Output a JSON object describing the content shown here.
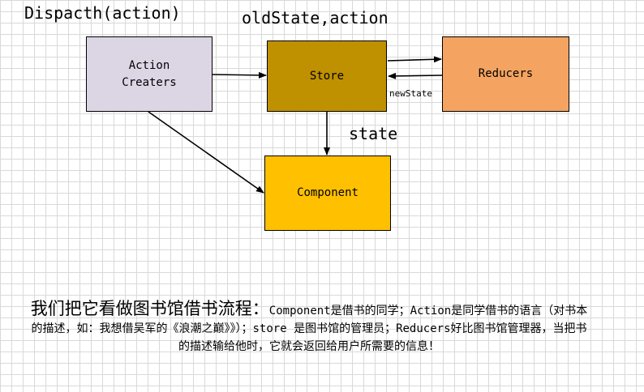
{
  "labels": {
    "title": "Dispacth(action)",
    "old_state": "oldState,action",
    "new_state": "newState",
    "state": "state"
  },
  "nodes": {
    "action": "Action\nCreaters",
    "store": "Store",
    "reducers": "Reducers",
    "component": "Component"
  },
  "colors": {
    "action": "#dcd6e4",
    "store": "#bf9000",
    "reducers": "#f4a460",
    "component": "#ffc000"
  },
  "description": {
    "lead": "我们把它看做图书馆借书流程：",
    "body": "Component是借书的同学；Action是同学借书的语言（对书本的描述，如：我想借吴军的《浪潮之巅》》）；store 是图书馆的管理员；Reducers好比图书馆管理器，当把书的描述输给他时，它就会返回给用户所需要的信息！"
  }
}
